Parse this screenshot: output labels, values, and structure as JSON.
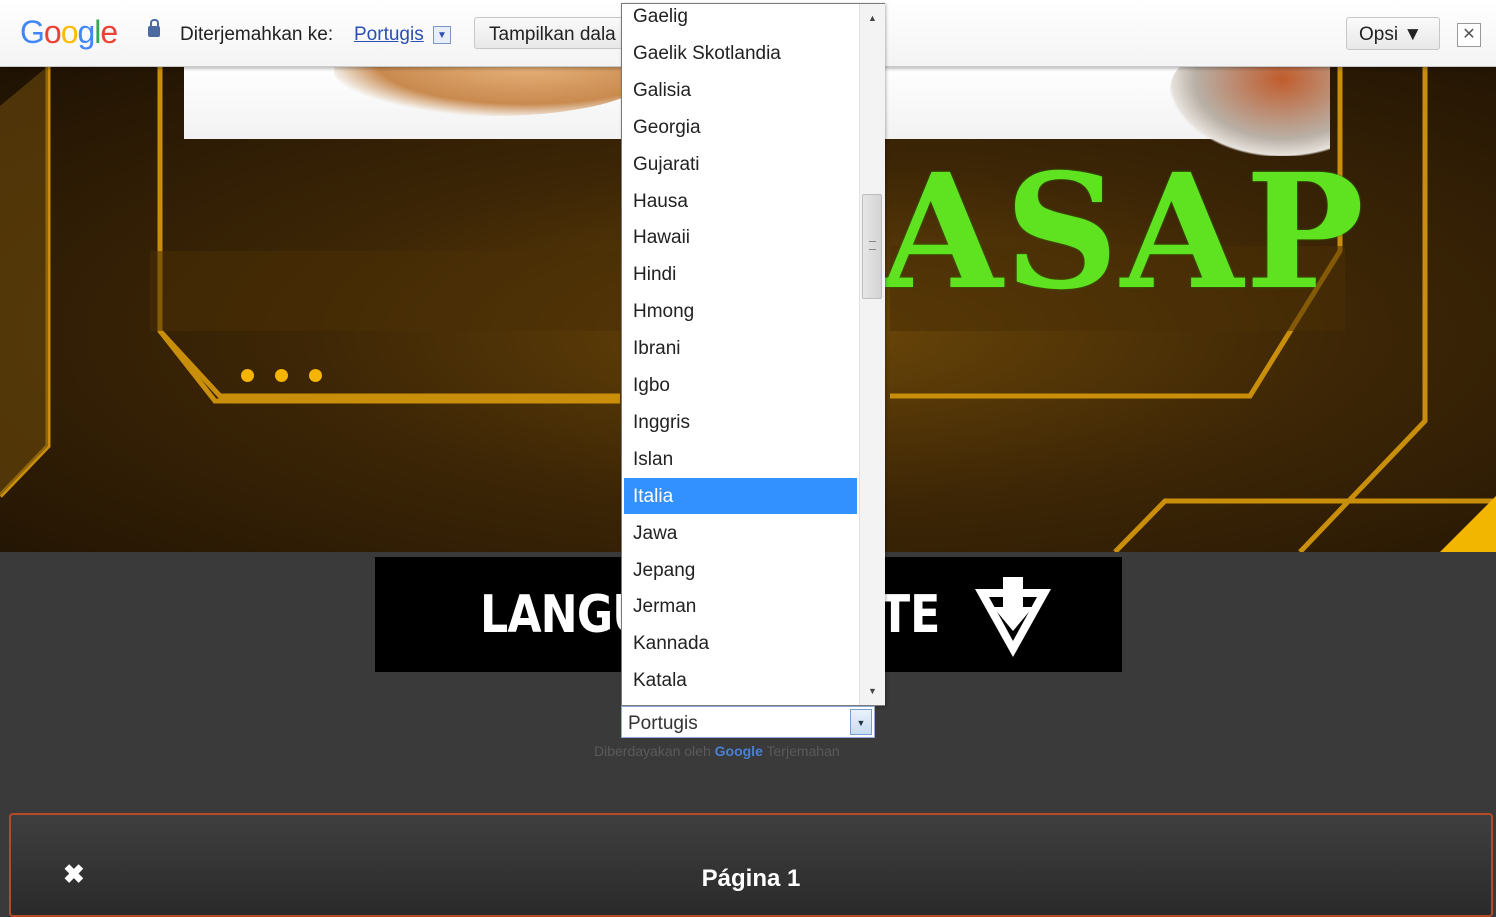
{
  "translate_bar": {
    "logo": [
      "G",
      "o",
      "o",
      "g",
      "l",
      "e"
    ],
    "logo_colors": [
      "#4285F4",
      "#EA4335",
      "#FBBC05",
      "#4285F4",
      "#34A853",
      "#EA4335"
    ],
    "translated_to_label": "Diterjemahkan ke:",
    "target_language": "Portugis",
    "show_original_label": "Tampilkan dala",
    "options_label": "Opsi ▼",
    "close_symbol": "✕"
  },
  "dropdown": {
    "items": [
      "Gaelig",
      "Gaelik Skotlandia",
      "Galisia",
      "Georgia",
      "Gujarati",
      "Hausa",
      "Hawaii",
      "Hindi",
      "Hmong",
      "Ibrani",
      "Igbo",
      "Inggris",
      "Islan",
      "Italia",
      "Jawa",
      "Jepang",
      "Jerman",
      "Kannada",
      "Katala"
    ],
    "selected": "Italia",
    "highlight_color": "#3391ff"
  },
  "hero": {
    "brand_text": "ASAP",
    "brand_color": "#5fe21f",
    "slider_dots": 3
  },
  "language_banner": {
    "text_left": "LANGUA",
    "text_right": "TE"
  },
  "language_select": {
    "value": "Portugis",
    "powered_by_prefix": "Diberdayakan oleh",
    "powered_by_brand": "Google",
    "powered_by_suffix": "Terjemahan"
  },
  "page_panel": {
    "close_symbol": "✖",
    "label": "Página 1",
    "border_color": "#b54a28"
  }
}
